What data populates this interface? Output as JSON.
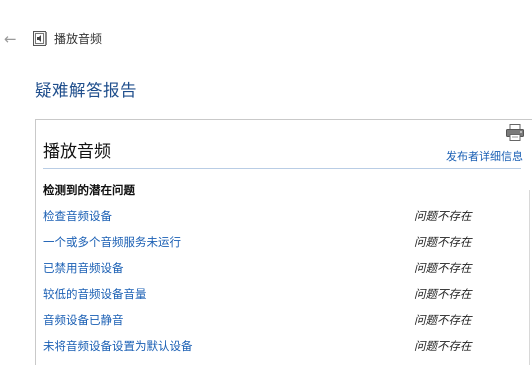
{
  "header": {
    "back_glyph": "←",
    "app_icon": "audio-troubleshooter-icon",
    "title": "播放音频"
  },
  "report": {
    "title": "疑难解答报告"
  },
  "section": {
    "title": "播放音频",
    "print_icon": "printer-icon",
    "publisher_link": "发布者详细信息",
    "issues_heading": "检测到的潜在问题",
    "issues": [
      {
        "label": "检查音频设备",
        "status": "问题不存在"
      },
      {
        "label": "一个或多个音频服务未运行",
        "status": "问题不存在"
      },
      {
        "label": "已禁用音频设备",
        "status": "问题不存在"
      },
      {
        "label": "较低的音频设备音量",
        "status": "问题不存在"
      },
      {
        "label": "音频设备已静音",
        "status": "问题不存在"
      },
      {
        "label": "未将音频设备设置为默认设备",
        "status": "问题不存在"
      }
    ]
  },
  "colors": {
    "link": "#1a5fb4",
    "report_title": "#1f4e8c",
    "divider": "#b9cde5"
  }
}
